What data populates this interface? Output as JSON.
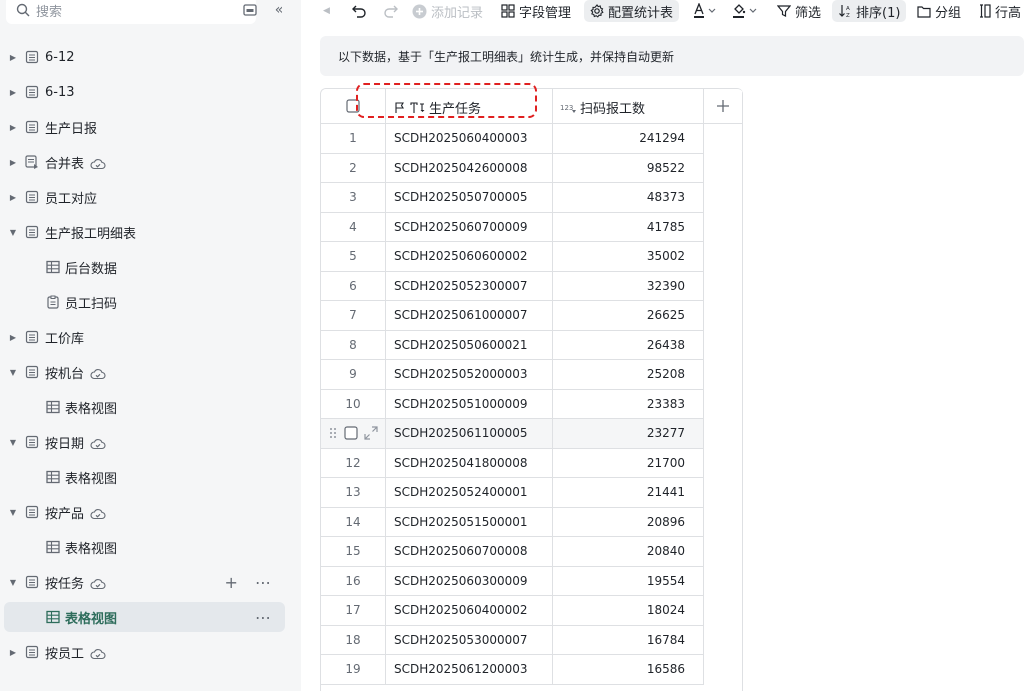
{
  "sidebar": {
    "search_placeholder": "搜索",
    "items": [
      {
        "label": "6-12",
        "caret": "▶",
        "cloud": false
      },
      {
        "label": "6-13",
        "caret": "▶",
        "cloud": false
      },
      {
        "label": "生产日报",
        "caret": "▶",
        "cloud": false
      },
      {
        "label": "合并表",
        "caret": "▶",
        "cloud": true
      },
      {
        "label": "员工对应",
        "caret": "▶",
        "cloud": false
      },
      {
        "label": "生产报工明细表",
        "caret": "▼",
        "cloud": false
      },
      {
        "label": "后台数据",
        "caret": "",
        "cloud": false
      },
      {
        "label": "员工扫码",
        "caret": "",
        "cloud": false
      },
      {
        "label": "工价库",
        "caret": "▶",
        "cloud": false
      },
      {
        "label": "按机台",
        "caret": "▼",
        "cloud": true
      },
      {
        "label": "表格视图",
        "caret": "",
        "cloud": false
      },
      {
        "label": "按日期",
        "caret": "▼",
        "cloud": true
      },
      {
        "label": "表格视图",
        "caret": "",
        "cloud": false
      },
      {
        "label": "按产品",
        "caret": "▼",
        "cloud": true
      },
      {
        "label": "表格视图",
        "caret": "",
        "cloud": false
      },
      {
        "label": "按任务",
        "caret": "▼",
        "cloud": true
      },
      {
        "label": "表格视图",
        "caret": "",
        "cloud": false
      },
      {
        "label": "按员工",
        "caret": "▶",
        "cloud": true
      }
    ]
  },
  "toolbar": {
    "add_record": "添加记录",
    "field_manage": "字段管理",
    "config_stats": "配置统计表",
    "filter": "筛选",
    "sort": "排序(1)",
    "group": "分组",
    "row_height": "行高"
  },
  "notice": "以下数据，基于「生产报工明细表」统计生成，并保持自动更新",
  "table": {
    "col_task": "生产任务",
    "col_count": "扫码报工数",
    "rows": [
      {
        "n": "1",
        "task": "SCDH2025060400003",
        "count": "241294"
      },
      {
        "n": "2",
        "task": "SCDH2025042600008",
        "count": "98522"
      },
      {
        "n": "3",
        "task": "SCDH2025050700005",
        "count": "48373"
      },
      {
        "n": "4",
        "task": "SCDH2025060700009",
        "count": "41785"
      },
      {
        "n": "5",
        "task": "SCDH2025060600002",
        "count": "35002"
      },
      {
        "n": "6",
        "task": "SCDH2025052300007",
        "count": "32390"
      },
      {
        "n": "7",
        "task": "SCDH2025061000007",
        "count": "26625"
      },
      {
        "n": "8",
        "task": "SCDH2025050600021",
        "count": "26438"
      },
      {
        "n": "9",
        "task": "SCDH2025052000003",
        "count": "25208"
      },
      {
        "n": "10",
        "task": "SCDH2025051000009",
        "count": "23383"
      },
      {
        "n": "",
        "task": "SCDH2025061100005",
        "count": "23277"
      },
      {
        "n": "12",
        "task": "SCDH2025041800008",
        "count": "21700"
      },
      {
        "n": "13",
        "task": "SCDH2025052400001",
        "count": "21441"
      },
      {
        "n": "14",
        "task": "SCDH2025051500001",
        "count": "20896"
      },
      {
        "n": "15",
        "task": "SCDH2025060700008",
        "count": "20840"
      },
      {
        "n": "16",
        "task": "SCDH2025060300009",
        "count": "19554"
      },
      {
        "n": "17",
        "task": "SCDH2025060400002",
        "count": "18024"
      },
      {
        "n": "18",
        "task": "SCDH2025053000007",
        "count": "16784"
      },
      {
        "n": "19",
        "task": "SCDH2025061200003",
        "count": "16586"
      }
    ]
  }
}
